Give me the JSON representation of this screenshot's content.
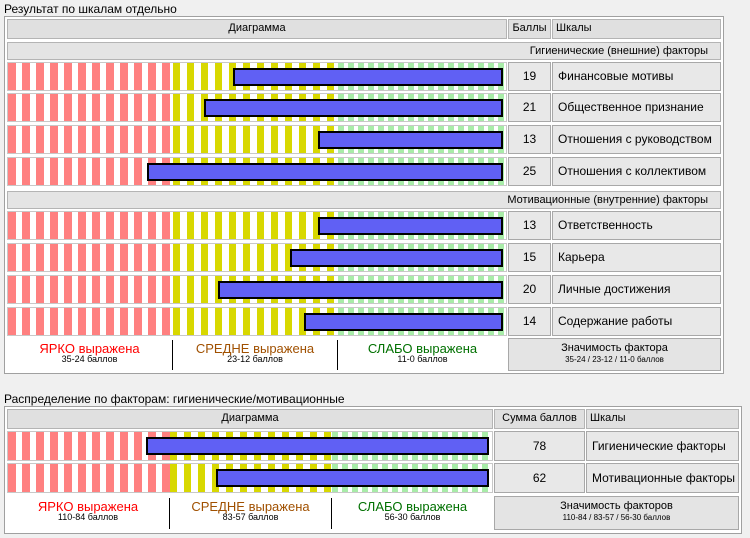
{
  "section1": {
    "title": "Результат по шкалам отдельно",
    "header": {
      "diagram": "Диаграмма",
      "points": "Баллы",
      "scales": "Шкалы"
    },
    "groups": [
      {
        "title": "Гигиенические (внешние) факторы",
        "rows": [
          {
            "score": "19",
            "label": "Финансовые мотивы"
          },
          {
            "score": "21",
            "label": "Общественное признание"
          },
          {
            "score": "13",
            "label": "Отношения с руководством"
          },
          {
            "score": "25",
            "label": "Отношения с коллективом"
          }
        ]
      },
      {
        "title": "Мотивационные (внутренние) факторы",
        "rows": [
          {
            "score": "13",
            "label": "Ответственность"
          },
          {
            "score": "15",
            "label": "Карьера"
          },
          {
            "score": "20",
            "label": "Личные достижения"
          },
          {
            "score": "14",
            "label": "Содержание работы"
          }
        ]
      }
    ],
    "legend": [
      {
        "text": "ЯРКО выражена",
        "sub": "35-24 баллов",
        "color": "#ff0000"
      },
      {
        "text": "СРЕДНЕ выражена",
        "sub": "23-12 баллов",
        "color": "#a05000"
      },
      {
        "text": "СЛАБО выражена",
        "sub": "11-0 баллов",
        "color": "#007000"
      }
    ],
    "significance": {
      "title": "Значимость фактора",
      "ranges": "35-24 / 23-12 / 11-0 баллов"
    },
    "scale": {
      "max": 35
    }
  },
  "section2": {
    "title": "Распределение по факторам: гигиенические/мотивационные",
    "header": {
      "diagram": "Диаграмма",
      "points": "Сумма баллов",
      "scales": "Шкалы"
    },
    "rows": [
      {
        "score": "78",
        "label": "Гигиенические факторы"
      },
      {
        "score": "62",
        "label": "Мотивационные факторы"
      }
    ],
    "legend": [
      {
        "text": "ЯРКО выражена",
        "sub": "110-84 баллов",
        "color": "#ff0000"
      },
      {
        "text": "СРЕДНЕ выражена",
        "sub": "83-57 баллов",
        "color": "#a05000"
      },
      {
        "text": "СЛАБО выражена",
        "sub": "56-30 баллов",
        "color": "#007000"
      }
    ],
    "significance": {
      "title": "Значимость факторов",
      "ranges": "110-84 / 83-57 / 56-30 баллов"
    },
    "scale": {
      "max": 110
    }
  },
  "colors": {
    "bar": "#6060f4",
    "strong": "#ff8080",
    "medium": "#d8d800",
    "weak": "#a8eca8"
  }
}
